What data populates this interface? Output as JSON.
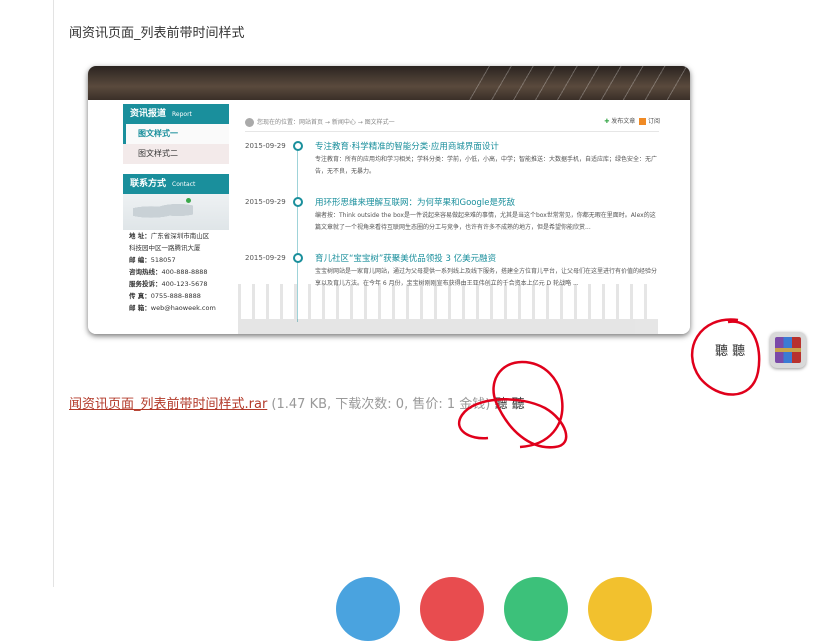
{
  "post": {
    "title": "闻资讯页面_列表前带时间样式"
  },
  "preview": {
    "sidebar": {
      "news_heading": "资讯报道",
      "news_heading_en": "Report",
      "items": [
        "图文样式一",
        "图文样式二"
      ],
      "contact_heading": "联系方式",
      "contact_heading_en": "Contact",
      "contact_lines": [
        {
          "label": "地 址：",
          "value": "广东省深圳市南山区"
        },
        {
          "label": "",
          "value": "科技园中区一路腾讯大厦"
        },
        {
          "label": "邮 编：",
          "value": "518057"
        },
        {
          "label": "咨询热线：",
          "value": "400-888-8888"
        },
        {
          "label": "服务投诉：",
          "value": "400-123-5678"
        },
        {
          "label": "传 真：",
          "value": "0755-888-8888"
        },
        {
          "label": "邮 箱：",
          "value": "web@haoweek.com"
        }
      ]
    },
    "breadcrumb": "您现在的位置：网站首页 → 新闻中心 → 图文样式一",
    "actions": {
      "post_label": "发布文章",
      "subscribe_label": "订阅"
    },
    "entries": [
      {
        "date": "2015-09-29",
        "title": "专注教育·科学精准的智能分类·应用商城界面设计",
        "summary": "专注教育：所有的应用均和学习相关；学科分类：学前，小低，小高，中学；智能推送：大数据手机，自适应库；绿色安全：无广告，无不良，无暴力。"
      },
      {
        "date": "2015-09-29",
        "title": "用环形思维来理解互联网：为何苹果和Google是死敌",
        "summary": "编者按：Think outside the box是一件说起来容易做起来难的事情，尤其是当这个box世常常见，你都无暇在里面时。Alex的这篇文章就了一个视角来看待互联网生态圈的分工与竞争，也许有许多不成熟的地方，但是希望你能欣赏..."
      },
      {
        "date": "2015-09-29",
        "title": "育儿社区“宝宝树”获聚美优品领投 3 亿美元融资",
        "summary": "宝宝树网站是一家育儿网站，通过为父母提供一系列线上及线下服务，搭建全方位育儿平台，让父母们在这里进行有价值的经验分享以及育儿方法。在今年 6 月份，宝宝树刚刚宣布获得由王亚伟创立的千合资本上亿元 D 轮战略 ..."
      }
    ]
  },
  "scribble_text": "聽 聽",
  "attachment": {
    "file_link": "闻资讯页面_列表前带时间样式.rar",
    "meta": " (1.47 KB, 下载次数: 0, 售价: 1 金钱) ",
    "trailing": "聽 聽"
  },
  "colors": {
    "accent": "#1a8f9c",
    "link": "#b33a2a",
    "annotation": "#e0001b"
  },
  "icons": {
    "archive": "rar-archive-icon"
  }
}
